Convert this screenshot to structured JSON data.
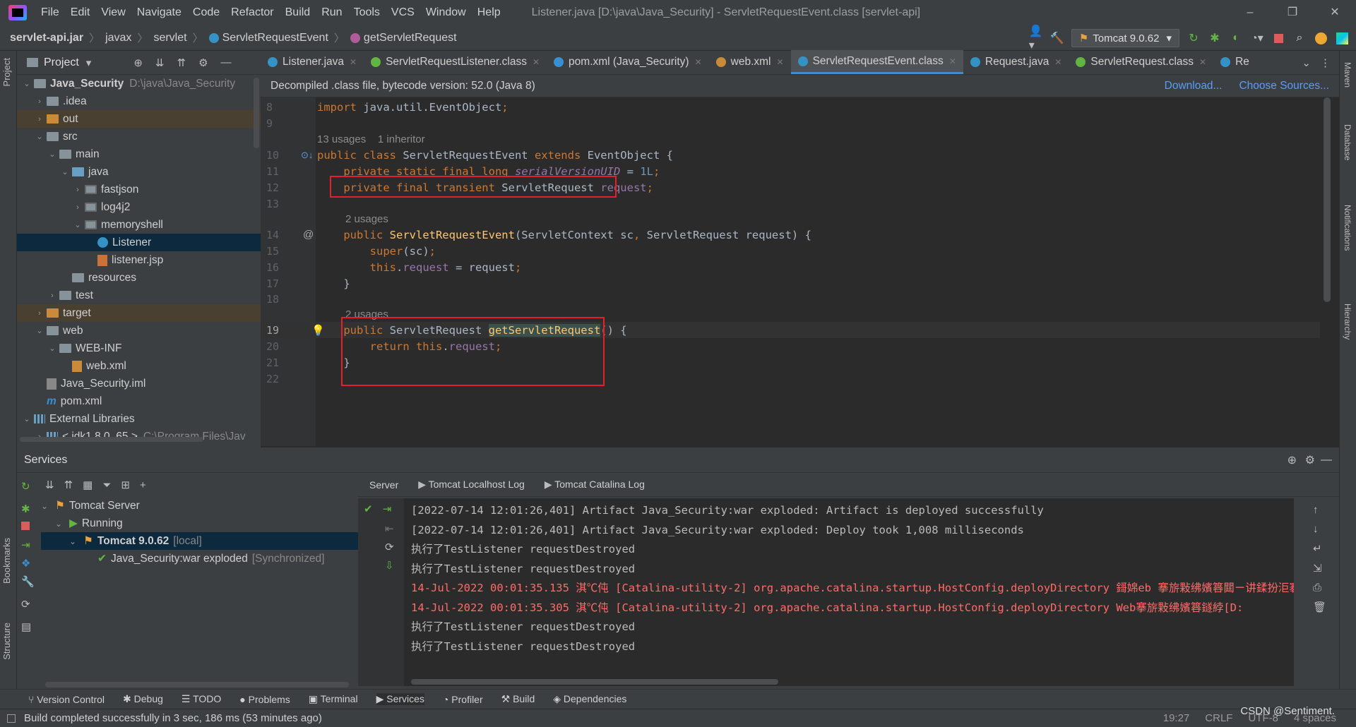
{
  "window": {
    "title": "Listener.java [D:\\java\\Java_Security] - ServletRequestEvent.class [servlet-api]",
    "menu": [
      "File",
      "Edit",
      "View",
      "Navigate",
      "Code",
      "Refactor",
      "Build",
      "Run",
      "Tools",
      "VCS",
      "Window",
      "Help"
    ],
    "controls": {
      "minimize": "–",
      "maximize": "❐",
      "close": "✕"
    }
  },
  "breadcrumb": [
    "servlet-api.jar",
    "javax",
    "servlet",
    "ServletRequestEvent",
    "getServletRequest"
  ],
  "toolbar": {
    "run_config": "Tomcat 9.0.62"
  },
  "project": {
    "title": "Project",
    "tree": [
      {
        "label": "Java_Security",
        "extra": "D:\\java\\Java_Security",
        "depth": 0,
        "open": true,
        "icon": "module",
        "bold": true
      },
      {
        "label": ".idea",
        "depth": 1,
        "open": false,
        "icon": "folder"
      },
      {
        "label": "out",
        "depth": 1,
        "open": false,
        "icon": "folder-orange",
        "hl": true
      },
      {
        "label": "src",
        "depth": 1,
        "open": true,
        "icon": "folder"
      },
      {
        "label": "main",
        "depth": 2,
        "open": true,
        "icon": "folder"
      },
      {
        "label": "java",
        "depth": 3,
        "open": true,
        "icon": "folder-blue"
      },
      {
        "label": "fastjson",
        "depth": 4,
        "open": false,
        "icon": "package"
      },
      {
        "label": "log4j2",
        "depth": 4,
        "open": false,
        "icon": "package"
      },
      {
        "label": "memoryshell",
        "depth": 4,
        "open": true,
        "icon": "package"
      },
      {
        "label": "Listener",
        "depth": 5,
        "icon": "class",
        "sel": true
      },
      {
        "label": "listener.jsp",
        "depth": 5,
        "icon": "jsp"
      },
      {
        "label": "resources",
        "depth": 3,
        "icon": "folder"
      },
      {
        "label": "test",
        "depth": 2,
        "open": false,
        "icon": "folder"
      },
      {
        "label": "target",
        "depth": 1,
        "open": false,
        "icon": "folder-orange",
        "hl": true
      },
      {
        "label": "web",
        "depth": 1,
        "open": true,
        "icon": "folder"
      },
      {
        "label": "WEB-INF",
        "depth": 2,
        "open": true,
        "icon": "folder"
      },
      {
        "label": "web.xml",
        "depth": 3,
        "icon": "xml"
      },
      {
        "label": "Java_Security.iml",
        "depth": 1,
        "icon": "iml"
      },
      {
        "label": "pom.xml",
        "depth": 1,
        "icon": "pom"
      },
      {
        "label": "External Libraries",
        "depth": 0,
        "open": true,
        "icon": "lib"
      },
      {
        "label": "< jdk1.8.0_65 >",
        "extra": "C:\\Program Files\\Jav",
        "depth": 1,
        "open": false,
        "icon": "lib"
      }
    ]
  },
  "editor": {
    "tabs": [
      {
        "label": "Listener.java",
        "color": "#3592c4"
      },
      {
        "label": "ServletRequestListener.class",
        "color": "#62b543"
      },
      {
        "label": "pom.xml (Java_Security)",
        "color": "#3a8fd0"
      },
      {
        "label": "web.xml",
        "color": "#c98a3a"
      },
      {
        "label": "ServletRequestEvent.class",
        "color": "#3592c4",
        "active": true
      },
      {
        "label": "Request.java",
        "color": "#3592c4"
      },
      {
        "label": "ServletRequest.class",
        "color": "#62b543"
      },
      {
        "label": "Re",
        "color": "#3592c4"
      }
    ],
    "banner": "Decompiled .class file, bytecode version: 52.0 (Java 8)",
    "banner_links": [
      "Download...",
      "Choose Sources..."
    ],
    "usages": {
      "class": "13 usages    1 inheritor",
      "ctor": "2 usages",
      "method": "2 usages"
    }
  },
  "services": {
    "title": "Services",
    "tree": [
      {
        "label": "Tomcat Server",
        "depth": 0
      },
      {
        "label": "Running",
        "depth": 1
      },
      {
        "label": "Tomcat 9.0.62",
        "extra": "[local]",
        "depth": 2,
        "sel": true
      },
      {
        "label": "Java_Security:war exploded",
        "extra": "[Synchronized]",
        "depth": 3
      }
    ],
    "console_tabs": [
      "Server",
      "Tomcat Localhost Log",
      "Tomcat Catalina Log"
    ],
    "console": [
      {
        "text": "[2022-07-14 12:01:26,401] Artifact Java_Security:war exploded: Artifact is deployed successfully",
        "err": false
      },
      {
        "text": "[2022-07-14 12:01:26,401] Artifact Java_Security:war exploded: Deploy took 1,008 milliseconds",
        "err": false
      },
      {
        "text": "执行了TestListener requestDestroyed",
        "err": false
      },
      {
        "text": "执行了TestListener requestDestroyed",
        "err": false
      },
      {
        "text": "14-Jul-2022 00:01:35.135 淇℃伅 [Catalina-utility-2] org.apache.catalina.startup.HostConfig.deployDirectory 鎶婂eb 搴旂敤绋嬪簭閮ㄧ讲鍒扮洰褰",
        "err": true
      },
      {
        "text": "14-Jul-2022 00:01:35.305 淇℃伅 [Catalina-utility-2] org.apache.catalina.startup.HostConfig.deployDirectory Web搴旂敤绋嬪簭鐩綍[D:",
        "err": true
      },
      {
        "text": "执行了TestListener requestDestroyed",
        "err": false
      },
      {
        "text": "执行了TestListener requestDestroyed",
        "err": false
      }
    ]
  },
  "bottom_tabs": [
    "Version Control",
    "Debug",
    "TODO",
    "Problems",
    "Terminal",
    "Services",
    "Profiler",
    "Build",
    "Dependencies"
  ],
  "status": {
    "message": "Build completed successfully in 3 sec, 186 ms (53 minutes ago)",
    "position": "19:27",
    "line_sep": "CRLF",
    "encoding": "UTF-8",
    "indent": "4 spaces",
    "watermark": "CSDN @Sentiment."
  },
  "side_tabs": {
    "left": [
      "Project",
      "Bookmarks",
      "Structure"
    ],
    "right": [
      "Maven",
      "Database",
      "Notifications",
      "Hierarchy"
    ]
  }
}
